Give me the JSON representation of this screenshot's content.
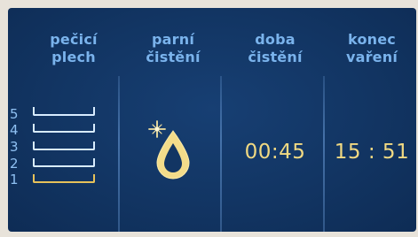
{
  "columns": {
    "tray": {
      "label_line1": "pečicí",
      "label_line2": "plech"
    },
    "steam": {
      "label_line1": "parní",
      "label_line2": "čistění"
    },
    "duration": {
      "label_line1": "doba",
      "label_line2": "čistění",
      "value": "00:45"
    },
    "end": {
      "label_line1": "konec",
      "label_line2": "vaření",
      "value": "15 : 51"
    }
  },
  "tray_levels": [
    "5",
    "4",
    "3",
    "2",
    "1"
  ],
  "active_level": "1",
  "icons": {
    "steam": "steam-drop-sparkle-icon"
  },
  "colors": {
    "background": "#123563",
    "label": "#7ab3ec",
    "value": "#f1d982",
    "tray_inactive": "#d8ecff",
    "tray_active": "#e6c15a"
  }
}
